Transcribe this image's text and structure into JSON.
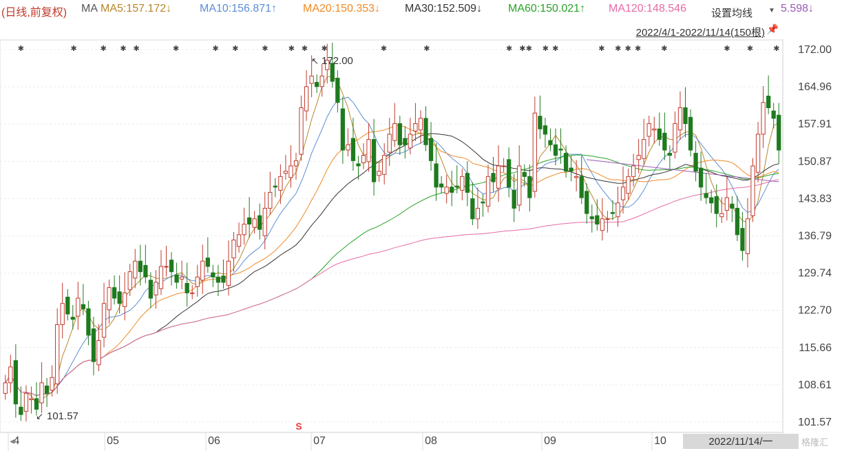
{
  "header": {
    "prefix": "(日线,前复权)",
    "ma_label": "MA",
    "indicators": [
      {
        "text": "MA5:157.172↓",
        "color": "#b8862a"
      },
      {
        "text": "MA10:156.871↑",
        "color": "#5b8ed6"
      },
      {
        "text": "MA20:150.353↓",
        "color": "#f08a24"
      },
      {
        "text": "MA30:152.509↓",
        "color": "#333333"
      },
      {
        "text": "MA60:150.021↑",
        "color": "#27a327"
      },
      {
        "text": "MA120:148.546",
        "color": "#e86aa6"
      }
    ],
    "overflow_value": "5.598↓",
    "overflow_color": "#9b59b6",
    "settings_label": "设置均线",
    "date_range": "2022/4/1-2022/11/14(150根)",
    "pin_icon": "pin-icon"
  },
  "chart_data": {
    "type": "candlestick",
    "title": "",
    "period": "2022/4/1-2022/11/14",
    "bars": 150,
    "y_ticks": [
      "172.00",
      "164.96",
      "157.91",
      "150.87",
      "143.83",
      "136.79",
      "129.74",
      "122.70",
      "115.66",
      "108.61",
      "101.57"
    ],
    "ylim": [
      101.57,
      172.0
    ],
    "x_labels": [
      "4",
      "05",
      "06",
      "07",
      "08",
      "09",
      "10"
    ],
    "last_date_label": "2022/11/14/一",
    "annotations": [
      {
        "text": "172.00",
        "note": "high"
      },
      {
        "text": "101.57",
        "note": "low"
      }
    ],
    "marker": "S",
    "up_color": "#c0392b",
    "down_color": "#1e7a1e",
    "series": [
      {
        "name": "MA5",
        "value": 157.172,
        "color": "#b8862a"
      },
      {
        "name": "MA10",
        "value": 156.871,
        "color": "#5b8ed6"
      },
      {
        "name": "MA20",
        "value": 150.353,
        "color": "#f08a24"
      },
      {
        "name": "MA30",
        "value": 152.509,
        "color": "#333333"
      },
      {
        "name": "MA60",
        "value": 150.021,
        "color": "#27a327"
      },
      {
        "name": "MA120",
        "value": 148.546,
        "color": "#e86aa6"
      }
    ],
    "closes": [
      109,
      112,
      105,
      103,
      107,
      106,
      104,
      109,
      107,
      110,
      120,
      124,
      122,
      121,
      125,
      123,
      118,
      113,
      117,
      124,
      127,
      125,
      124,
      126,
      130,
      132,
      130,
      129,
      125,
      128,
      131,
      131,
      130,
      128,
      129,
      126,
      126,
      129,
      132,
      131,
      129,
      128,
      128,
      132,
      136,
      137,
      139,
      139,
      140,
      138,
      142,
      145,
      146,
      148,
      149,
      150,
      151,
      161,
      165,
      167,
      165,
      167,
      170,
      166,
      162,
      153,
      154,
      151,
      150,
      152,
      155,
      147,
      149,
      152,
      156,
      158,
      154,
      154,
      156,
      158,
      159,
      154,
      151,
      146,
      146,
      146,
      145,
      146,
      148,
      145,
      140,
      142,
      143,
      148,
      147,
      150,
      150,
      146,
      142,
      150,
      148,
      144,
      160,
      157,
      156,
      154,
      152,
      153,
      149,
      149,
      148,
      144,
      141,
      140,
      139,
      140,
      140,
      141,
      143,
      146,
      148,
      150,
      152,
      155,
      158,
      157,
      155,
      153,
      152,
      158,
      161,
      158,
      153,
      149,
      146,
      144,
      143,
      141,
      141,
      144,
      142,
      137,
      134,
      140,
      150,
      156,
      162,
      161,
      159,
      153
    ]
  },
  "footer": {
    "watermark": "格隆汇"
  }
}
